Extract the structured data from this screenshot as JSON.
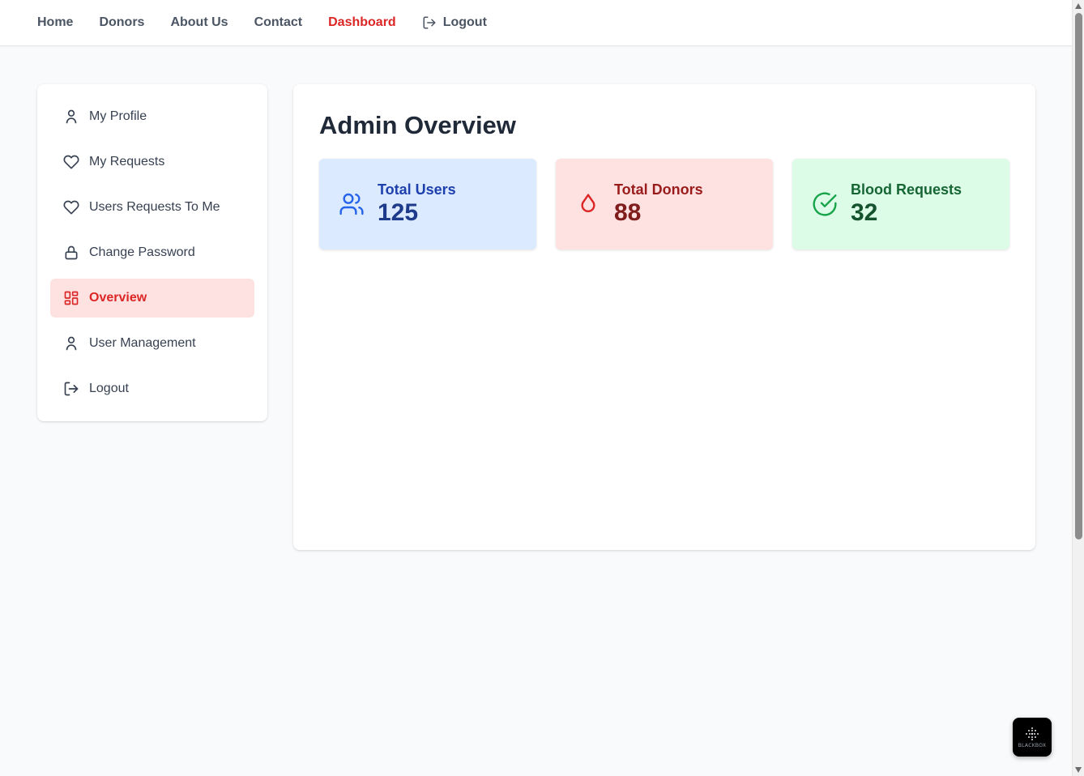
{
  "nav": {
    "home": "Home",
    "donors": "Donors",
    "about": "About Us",
    "contact": "Contact",
    "dashboard": "Dashboard",
    "logout": "Logout"
  },
  "sidebar": {
    "items": [
      {
        "label": "My Profile",
        "icon": "user-icon"
      },
      {
        "label": "My Requests",
        "icon": "heart-icon"
      },
      {
        "label": "Users Requests To Me",
        "icon": "heart-icon"
      },
      {
        "label": "Change Password",
        "icon": "lock-icon"
      },
      {
        "label": "Overview",
        "icon": "grid-icon",
        "active": true
      },
      {
        "label": "User Management",
        "icon": "user-icon"
      },
      {
        "label": "Logout",
        "icon": "logout-icon"
      }
    ]
  },
  "main": {
    "title": "Admin Overview",
    "cards": [
      {
        "label": "Total Users",
        "value": "125",
        "icon": "users-icon"
      },
      {
        "label": "Total Donors",
        "value": "88",
        "icon": "droplet-icon"
      },
      {
        "label": "Blood Requests",
        "value": "32",
        "icon": "check-circle-icon"
      }
    ]
  },
  "badge": {
    "text": "BLACKBOX"
  },
  "colors": {
    "accent": "#dc2626",
    "active_bg": "#fee2e2",
    "users_card_bg": "#dbeafe",
    "donors_card_bg": "#fee2e2",
    "requests_card_bg": "#dcfce7"
  }
}
